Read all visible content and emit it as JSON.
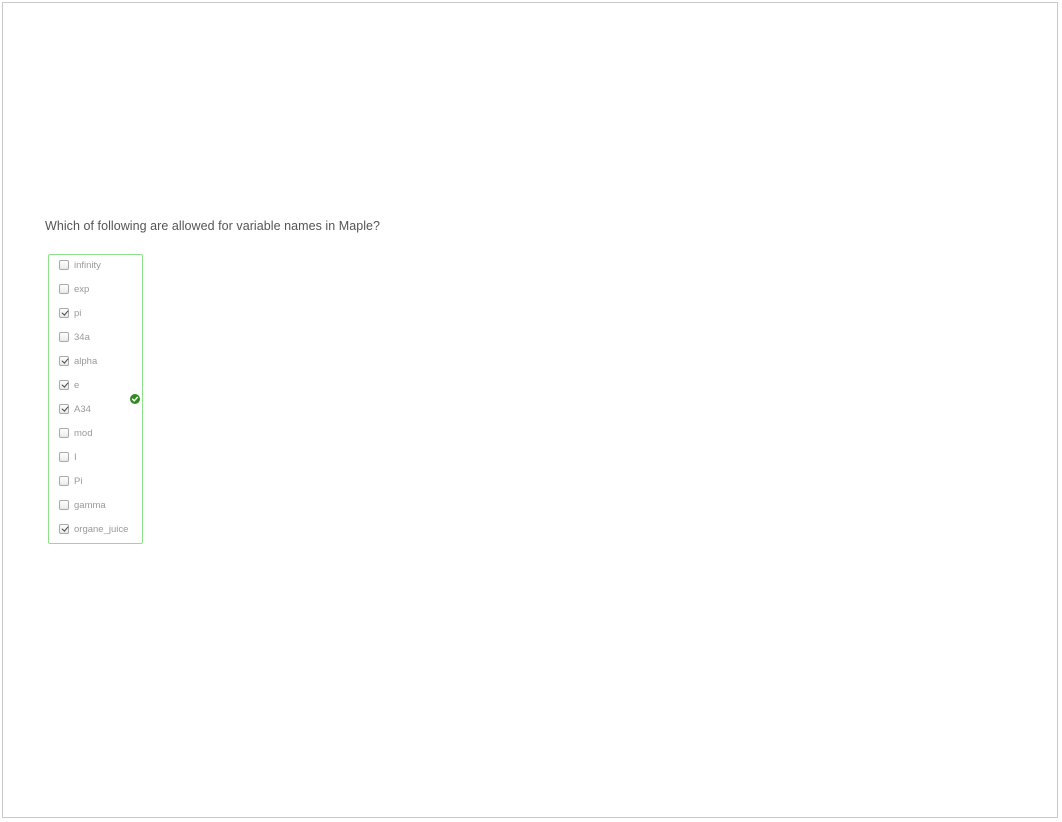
{
  "question": {
    "text": "Which of following are allowed for variable names in Maple?"
  },
  "options": [
    {
      "label": "infinity",
      "checked": false
    },
    {
      "label": "exp",
      "checked": false
    },
    {
      "label": "pi",
      "checked": true
    },
    {
      "label": "34a",
      "checked": false
    },
    {
      "label": "alpha",
      "checked": true
    },
    {
      "label": "e",
      "checked": true
    },
    {
      "label": "A34",
      "checked": true
    },
    {
      "label": "mod",
      "checked": false
    },
    {
      "label": "I",
      "checked": false
    },
    {
      "label": "Pi",
      "checked": false
    },
    {
      "label": "gamma",
      "checked": false
    },
    {
      "label": "organe_juice",
      "checked": true
    }
  ],
  "feedback": {
    "icon": "checkmark-circle-icon",
    "status": "correct",
    "color": "#2e8b1f",
    "box_border_color": "#8fe08a"
  }
}
